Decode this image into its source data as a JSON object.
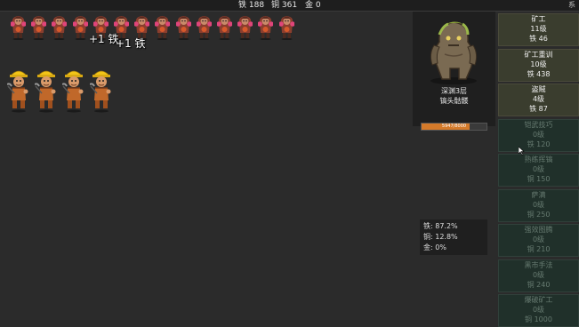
{
  "topbar": {
    "iron": "铁 188",
    "copper": "铜 361",
    "gold": "金 0",
    "corner": "系"
  },
  "field": {
    "float_texts": [
      "+1 铁",
      "+1 铁"
    ],
    "enemies_count": 14,
    "miners_count": 4
  },
  "boss": {
    "floor": "深渊3层",
    "name": "镐头骷髅",
    "hp_text": "5947/8000",
    "hp_fraction": 0.743
  },
  "ratios": {
    "iron": "铁:  87.2%",
    "copper": "铜:  12.8%",
    "gold": "金:  0%"
  },
  "shop": {
    "items": [
      {
        "name": "矿工",
        "level": "11级",
        "cost": "铁 46",
        "state": "active"
      },
      {
        "name": "矿工重训",
        "level": "10级",
        "cost": "铁 438",
        "state": "active"
      },
      {
        "name": "盗贼",
        "level": "4级",
        "cost": "铁 87",
        "state": "active"
      },
      {
        "name": "铠武技巧",
        "level": "0级",
        "cost": "铁 120",
        "state": "locked"
      },
      {
        "name": "熟练挥镐",
        "level": "0级",
        "cost": "铜 150",
        "state": "locked"
      },
      {
        "name": "萨满",
        "level": "0级",
        "cost": "铜 250",
        "state": "locked"
      },
      {
        "name": "强效图腾",
        "level": "0级",
        "cost": "铜 210",
        "state": "locked"
      },
      {
        "name": "黑市手法",
        "level": "0级",
        "cost": "铜 240",
        "state": "locked"
      },
      {
        "name": "爆破矿工",
        "level": "0级",
        "cost": "铜 1000",
        "state": "locked"
      }
    ]
  },
  "colors": {
    "active_bg": "#3a3d2e",
    "locked_bg": "#20302a",
    "hp_fill": "#d47a2a"
  }
}
